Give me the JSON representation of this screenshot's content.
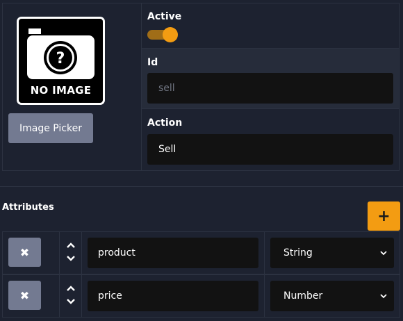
{
  "image": {
    "no_image_text": "NO IMAGE",
    "icon": "camera-question-icon"
  },
  "picker": {
    "label": "Image Picker"
  },
  "fields": {
    "active": {
      "label": "Active",
      "value": true
    },
    "id": {
      "label": "Id",
      "placeholder": "sell"
    },
    "action": {
      "label": "Action",
      "value": "Sell"
    }
  },
  "attributes": {
    "title": "Attributes",
    "add_label": "+",
    "rows": [
      {
        "name": "product",
        "type": "String"
      },
      {
        "name": "price",
        "type": "Number"
      }
    ]
  },
  "colors": {
    "accent": "#f39c12",
    "panel": "#1d2230",
    "input": "#121212",
    "button": "#737a91"
  }
}
